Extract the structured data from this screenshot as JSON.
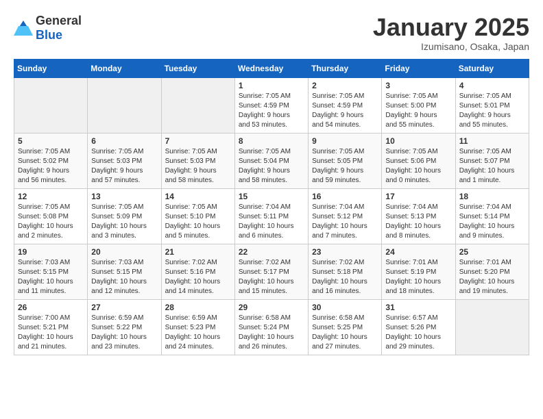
{
  "logo": {
    "general": "General",
    "blue": "Blue"
  },
  "header": {
    "month": "January 2025",
    "location": "Izumisano, Osaka, Japan"
  },
  "weekdays": [
    "Sunday",
    "Monday",
    "Tuesday",
    "Wednesday",
    "Thursday",
    "Friday",
    "Saturday"
  ],
  "weeks": [
    [
      {
        "day": "",
        "info": ""
      },
      {
        "day": "",
        "info": ""
      },
      {
        "day": "",
        "info": ""
      },
      {
        "day": "1",
        "info": "Sunrise: 7:05 AM\nSunset: 4:59 PM\nDaylight: 9 hours\nand 53 minutes."
      },
      {
        "day": "2",
        "info": "Sunrise: 7:05 AM\nSunset: 4:59 PM\nDaylight: 9 hours\nand 54 minutes."
      },
      {
        "day": "3",
        "info": "Sunrise: 7:05 AM\nSunset: 5:00 PM\nDaylight: 9 hours\nand 55 minutes."
      },
      {
        "day": "4",
        "info": "Sunrise: 7:05 AM\nSunset: 5:01 PM\nDaylight: 9 hours\nand 55 minutes."
      }
    ],
    [
      {
        "day": "5",
        "info": "Sunrise: 7:05 AM\nSunset: 5:02 PM\nDaylight: 9 hours\nand 56 minutes."
      },
      {
        "day": "6",
        "info": "Sunrise: 7:05 AM\nSunset: 5:03 PM\nDaylight: 9 hours\nand 57 minutes."
      },
      {
        "day": "7",
        "info": "Sunrise: 7:05 AM\nSunset: 5:03 PM\nDaylight: 9 hours\nand 58 minutes."
      },
      {
        "day": "8",
        "info": "Sunrise: 7:05 AM\nSunset: 5:04 PM\nDaylight: 9 hours\nand 58 minutes."
      },
      {
        "day": "9",
        "info": "Sunrise: 7:05 AM\nSunset: 5:05 PM\nDaylight: 9 hours\nand 59 minutes."
      },
      {
        "day": "10",
        "info": "Sunrise: 7:05 AM\nSunset: 5:06 PM\nDaylight: 10 hours\nand 0 minutes."
      },
      {
        "day": "11",
        "info": "Sunrise: 7:05 AM\nSunset: 5:07 PM\nDaylight: 10 hours\nand 1 minute."
      }
    ],
    [
      {
        "day": "12",
        "info": "Sunrise: 7:05 AM\nSunset: 5:08 PM\nDaylight: 10 hours\nand 2 minutes."
      },
      {
        "day": "13",
        "info": "Sunrise: 7:05 AM\nSunset: 5:09 PM\nDaylight: 10 hours\nand 3 minutes."
      },
      {
        "day": "14",
        "info": "Sunrise: 7:05 AM\nSunset: 5:10 PM\nDaylight: 10 hours\nand 5 minutes."
      },
      {
        "day": "15",
        "info": "Sunrise: 7:04 AM\nSunset: 5:11 PM\nDaylight: 10 hours\nand 6 minutes."
      },
      {
        "day": "16",
        "info": "Sunrise: 7:04 AM\nSunset: 5:12 PM\nDaylight: 10 hours\nand 7 minutes."
      },
      {
        "day": "17",
        "info": "Sunrise: 7:04 AM\nSunset: 5:13 PM\nDaylight: 10 hours\nand 8 minutes."
      },
      {
        "day": "18",
        "info": "Sunrise: 7:04 AM\nSunset: 5:14 PM\nDaylight: 10 hours\nand 9 minutes."
      }
    ],
    [
      {
        "day": "19",
        "info": "Sunrise: 7:03 AM\nSunset: 5:15 PM\nDaylight: 10 hours\nand 11 minutes."
      },
      {
        "day": "20",
        "info": "Sunrise: 7:03 AM\nSunset: 5:15 PM\nDaylight: 10 hours\nand 12 minutes."
      },
      {
        "day": "21",
        "info": "Sunrise: 7:02 AM\nSunset: 5:16 PM\nDaylight: 10 hours\nand 14 minutes."
      },
      {
        "day": "22",
        "info": "Sunrise: 7:02 AM\nSunset: 5:17 PM\nDaylight: 10 hours\nand 15 minutes."
      },
      {
        "day": "23",
        "info": "Sunrise: 7:02 AM\nSunset: 5:18 PM\nDaylight: 10 hours\nand 16 minutes."
      },
      {
        "day": "24",
        "info": "Sunrise: 7:01 AM\nSunset: 5:19 PM\nDaylight: 10 hours\nand 18 minutes."
      },
      {
        "day": "25",
        "info": "Sunrise: 7:01 AM\nSunset: 5:20 PM\nDaylight: 10 hours\nand 19 minutes."
      }
    ],
    [
      {
        "day": "26",
        "info": "Sunrise: 7:00 AM\nSunset: 5:21 PM\nDaylight: 10 hours\nand 21 minutes."
      },
      {
        "day": "27",
        "info": "Sunrise: 6:59 AM\nSunset: 5:22 PM\nDaylight: 10 hours\nand 23 minutes."
      },
      {
        "day": "28",
        "info": "Sunrise: 6:59 AM\nSunset: 5:23 PM\nDaylight: 10 hours\nand 24 minutes."
      },
      {
        "day": "29",
        "info": "Sunrise: 6:58 AM\nSunset: 5:24 PM\nDaylight: 10 hours\nand 26 minutes."
      },
      {
        "day": "30",
        "info": "Sunrise: 6:58 AM\nSunset: 5:25 PM\nDaylight: 10 hours\nand 27 minutes."
      },
      {
        "day": "31",
        "info": "Sunrise: 6:57 AM\nSunset: 5:26 PM\nDaylight: 10 hours\nand 29 minutes."
      },
      {
        "day": "",
        "info": ""
      }
    ]
  ]
}
